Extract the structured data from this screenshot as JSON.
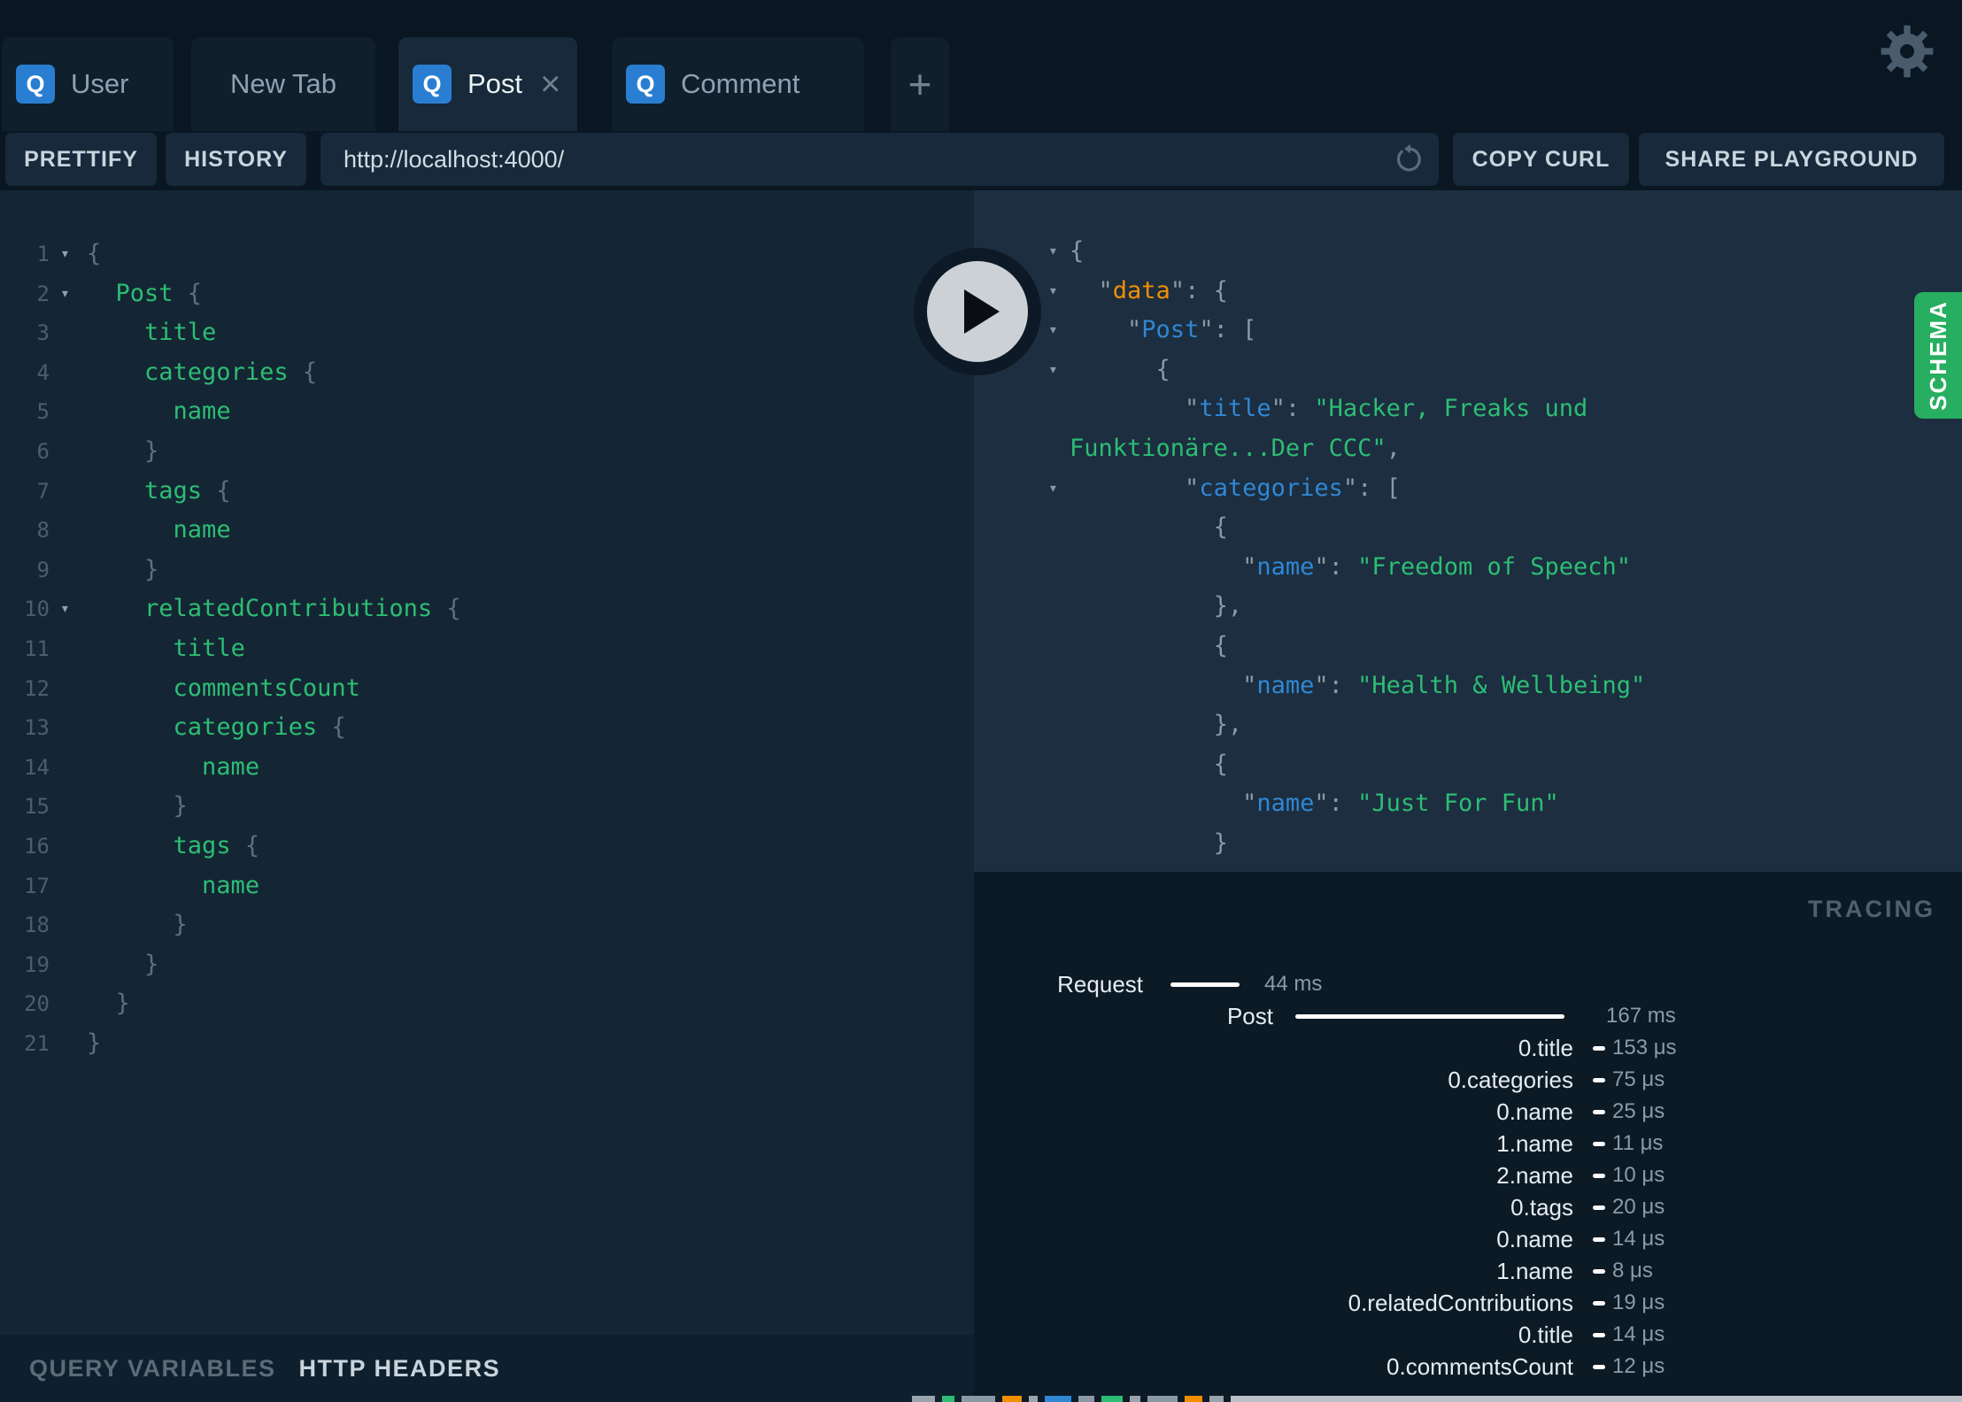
{
  "colors": {
    "accent_blue": "#2a7ed2",
    "schema_green": "#27ae60",
    "code_green": "#2dbd74",
    "key_blue": "#3087d4",
    "key_orange": "#f18f01"
  },
  "icons": {
    "fold_arrow": "▾",
    "close": "×",
    "plus": "+",
    "query_badge": "Q",
    "gear": "settings-gear",
    "reload": "reload-arrow",
    "play": "play-triangle"
  },
  "tabs": {
    "badge": "Q",
    "items": [
      {
        "label": "User",
        "active": false
      },
      {
        "label": "New Tab",
        "active": false
      },
      {
        "label": "Post",
        "active": true
      },
      {
        "label": "Comment",
        "active": false
      }
    ]
  },
  "toolbar": {
    "prettify": "PRETTIFY",
    "history": "HISTORY",
    "url": "http://localhost:4000/",
    "copy_curl": "COPY CURL",
    "share": "SHARE PLAYGROUND"
  },
  "editor": {
    "lines": [
      {
        "num": "1",
        "fold": true,
        "code": [
          [
            "p",
            "{"
          ]
        ]
      },
      {
        "num": "2",
        "fold": true,
        "code": [
          [
            "w",
            "  "
          ],
          [
            "f",
            "Post"
          ],
          [
            "p",
            " {"
          ]
        ]
      },
      {
        "num": "3",
        "code": [
          [
            "w",
            "    "
          ],
          [
            "f",
            "title"
          ]
        ]
      },
      {
        "num": "4",
        "code": [
          [
            "w",
            "    "
          ],
          [
            "f",
            "categories"
          ],
          [
            "p",
            " {"
          ]
        ]
      },
      {
        "num": "5",
        "code": [
          [
            "w",
            "      "
          ],
          [
            "f",
            "name"
          ]
        ]
      },
      {
        "num": "6",
        "code": [
          [
            "w",
            "    "
          ],
          [
            "p",
            "}"
          ]
        ]
      },
      {
        "num": "7",
        "code": [
          [
            "w",
            "    "
          ],
          [
            "f",
            "tags"
          ],
          [
            "p",
            " {"
          ]
        ]
      },
      {
        "num": "8",
        "code": [
          [
            "w",
            "      "
          ],
          [
            "f",
            "name"
          ]
        ]
      },
      {
        "num": "9",
        "code": [
          [
            "w",
            "    "
          ],
          [
            "p",
            "}"
          ]
        ]
      },
      {
        "num": "10",
        "fold": true,
        "code": [
          [
            "w",
            "    "
          ],
          [
            "f",
            "relatedContributions"
          ],
          [
            "p",
            " {"
          ]
        ]
      },
      {
        "num": "11",
        "code": [
          [
            "w",
            "      "
          ],
          [
            "f",
            "title"
          ]
        ]
      },
      {
        "num": "12",
        "code": [
          [
            "w",
            "      "
          ],
          [
            "f",
            "commentsCount"
          ]
        ]
      },
      {
        "num": "13",
        "code": [
          [
            "w",
            "      "
          ],
          [
            "f",
            "categories"
          ],
          [
            "p",
            " {"
          ]
        ]
      },
      {
        "num": "14",
        "code": [
          [
            "w",
            "        "
          ],
          [
            "f",
            "name"
          ]
        ]
      },
      {
        "num": "15",
        "code": [
          [
            "w",
            "      "
          ],
          [
            "p",
            "}"
          ]
        ]
      },
      {
        "num": "16",
        "code": [
          [
            "w",
            "      "
          ],
          [
            "f",
            "tags"
          ],
          [
            "p",
            " {"
          ]
        ]
      },
      {
        "num": "17",
        "code": [
          [
            "w",
            "        "
          ],
          [
            "f",
            "name"
          ]
        ]
      },
      {
        "num": "18",
        "code": [
          [
            "w",
            "      "
          ],
          [
            "p",
            "}"
          ]
        ]
      },
      {
        "num": "19",
        "code": [
          [
            "w",
            "    "
          ],
          [
            "p",
            "}"
          ]
        ]
      },
      {
        "num": "20",
        "code": [
          [
            "w",
            "  "
          ],
          [
            "p",
            "}"
          ]
        ]
      },
      {
        "num": "21",
        "code": [
          [
            "p",
            "}"
          ]
        ]
      }
    ]
  },
  "response": {
    "lines": [
      {
        "fold": true,
        "code": [
          [
            "rp",
            "{"
          ]
        ]
      },
      {
        "fold": true,
        "code": [
          [
            "w",
            "  "
          ],
          [
            "rp",
            "\""
          ],
          [
            "ko",
            "data"
          ],
          [
            "rp",
            "\": {"
          ]
        ]
      },
      {
        "fold": true,
        "code": [
          [
            "w",
            "    "
          ],
          [
            "rp",
            "\""
          ],
          [
            "kb",
            "Post"
          ],
          [
            "rp",
            "\": ["
          ]
        ]
      },
      {
        "fold": true,
        "code": [
          [
            "w",
            "      "
          ],
          [
            "rp",
            "{"
          ]
        ]
      },
      {
        "code": [
          [
            "w",
            "        "
          ],
          [
            "rp",
            "\""
          ],
          [
            "kb",
            "title"
          ],
          [
            "rp",
            "\": "
          ],
          [
            "v",
            "\"Hacker, Freaks und"
          ]
        ]
      },
      {
        "code": [
          [
            "v",
            "Funktionäre...Der CCC\""
          ],
          [
            "rp",
            ","
          ]
        ]
      },
      {
        "fold": true,
        "code": [
          [
            "w",
            "        "
          ],
          [
            "rp",
            "\""
          ],
          [
            "kb",
            "categories"
          ],
          [
            "rp",
            "\": ["
          ]
        ]
      },
      {
        "code": [
          [
            "w",
            "          "
          ],
          [
            "rp",
            "{"
          ]
        ]
      },
      {
        "code": [
          [
            "w",
            "            "
          ],
          [
            "rp",
            "\""
          ],
          [
            "kb",
            "name"
          ],
          [
            "rp",
            "\": "
          ],
          [
            "v",
            "\"Freedom of Speech\""
          ]
        ]
      },
      {
        "code": [
          [
            "w",
            "          "
          ],
          [
            "rp",
            "},"
          ]
        ]
      },
      {
        "code": [
          [
            "w",
            "          "
          ],
          [
            "rp",
            "{"
          ]
        ]
      },
      {
        "code": [
          [
            "w",
            "            "
          ],
          [
            "rp",
            "\""
          ],
          [
            "kb",
            "name"
          ],
          [
            "rp",
            "\": "
          ],
          [
            "v",
            "\"Health & Wellbeing\""
          ]
        ]
      },
      {
        "code": [
          [
            "w",
            "          "
          ],
          [
            "rp",
            "},"
          ]
        ]
      },
      {
        "code": [
          [
            "w",
            "          "
          ],
          [
            "rp",
            "{"
          ]
        ]
      },
      {
        "code": [
          [
            "w",
            "            "
          ],
          [
            "rp",
            "\""
          ],
          [
            "kb",
            "name"
          ],
          [
            "rp",
            "\": "
          ],
          [
            "v",
            "\"Just For Fun\""
          ]
        ]
      },
      {
        "code": [
          [
            "w",
            "          "
          ],
          [
            "rp",
            "}"
          ]
        ]
      },
      {
        "code": [
          [
            "w",
            "        "
          ],
          [
            "rp",
            "]"
          ]
        ]
      }
    ]
  },
  "tracing": {
    "title": "TRACING",
    "rows": [
      {
        "label": "Request",
        "lw": 191,
        "bm": 31,
        "bw": 78,
        "vm": 28,
        "value": "44 ms"
      },
      {
        "label": "Post",
        "lw": 338,
        "bm": 25,
        "bw": 304,
        "vm": 47,
        "value": "167 ms"
      },
      {
        "label": "0.title",
        "lw": 677,
        "bm": 22,
        "bw": 14,
        "vm": 8,
        "value": "153 μs"
      },
      {
        "label": "0.categories",
        "lw": 677,
        "bm": 22,
        "bw": 14,
        "vm": 8,
        "value": "75 μs"
      },
      {
        "label": "0.name",
        "lw": 677,
        "bm": 22,
        "bw": 14,
        "vm": 8,
        "value": "25 μs"
      },
      {
        "label": "1.name",
        "lw": 677,
        "bm": 22,
        "bw": 14,
        "vm": 8,
        "value": "11 μs"
      },
      {
        "label": "2.name",
        "lw": 677,
        "bm": 22,
        "bw": 14,
        "vm": 8,
        "value": "10 μs"
      },
      {
        "label": "0.tags",
        "lw": 677,
        "bm": 22,
        "bw": 14,
        "vm": 8,
        "value": "20 μs"
      },
      {
        "label": "0.name",
        "lw": 677,
        "bm": 22,
        "bw": 14,
        "vm": 8,
        "value": "14 μs"
      },
      {
        "label": "1.name",
        "lw": 677,
        "bm": 22,
        "bw": 14,
        "vm": 8,
        "value": "8 μs"
      },
      {
        "label": "0.relatedContributions",
        "lw": 677,
        "bm": 22,
        "bw": 14,
        "vm": 8,
        "value": "19 μs"
      },
      {
        "label": "0.title",
        "lw": 677,
        "bm": 22,
        "bw": 14,
        "vm": 8,
        "value": "14 μs"
      },
      {
        "label": "0.commentsCount",
        "lw": 677,
        "bm": 22,
        "bw": 14,
        "vm": 8,
        "value": "12 μs"
      }
    ]
  },
  "vars_bar": {
    "query_variables": "QUERY VARIABLES",
    "http_headers": "HTTP HEADERS"
  },
  "schema_tab": {
    "label": "SCHEMA"
  }
}
